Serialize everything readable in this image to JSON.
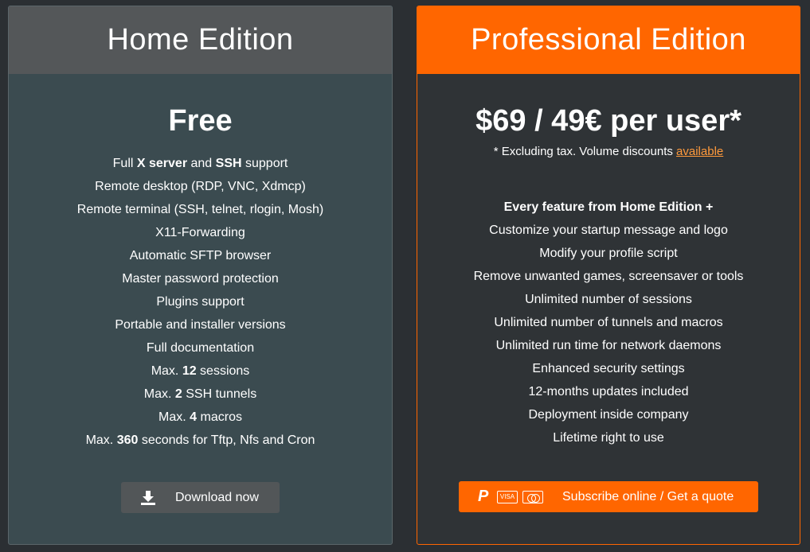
{
  "home": {
    "title": "Home Edition",
    "price": "Free",
    "features": [
      {
        "pre": "Full ",
        "bold": "X server",
        "mid": " and ",
        "bold2": "SSH",
        "post": " support"
      },
      {
        "pre": "Remote desktop (RDP, VNC, Xdmcp)"
      },
      {
        "pre": "Remote terminal (SSH, telnet, rlogin, Mosh)"
      },
      {
        "pre": "X11-Forwarding"
      },
      {
        "pre": "Automatic SFTP browser"
      },
      {
        "pre": "Master password protection"
      },
      {
        "pre": "Plugins support"
      },
      {
        "pre": "Portable and installer versions"
      },
      {
        "pre": "Full documentation"
      },
      {
        "pre": "Max. ",
        "bold": "12",
        "post": " sessions"
      },
      {
        "pre": "Max. ",
        "bold": "2",
        "post": " SSH tunnels"
      },
      {
        "pre": "Max. ",
        "bold": "4",
        "post": " macros"
      },
      {
        "pre": "Max. ",
        "bold": "360",
        "post": " seconds for Tftp, Nfs and Cron"
      }
    ],
    "button_label": "Download now",
    "button_icon": "download-icon",
    "header_color": "#545759",
    "body_color": "#3b4b50"
  },
  "pro": {
    "title": "Professional Edition",
    "price": "$69 / 49€ per user*",
    "note_text": "* Excluding tax. Volume discounts ",
    "note_link": "available",
    "features": [
      "Every feature from Home Edition +",
      "Customize your startup message and logo",
      "Modify your profile script",
      "Remove unwanted games, screensaver or tools",
      "Unlimited number of sessions",
      "Unlimited number of tunnels and macros",
      "Unlimited run time for network daemons",
      "Enhanced security settings",
      "12-months updates included",
      "Deployment inside company",
      "Lifetime right to use"
    ],
    "visa_label": "VISA",
    "button_label": "Subscribe online / Get a quote",
    "button_icons": [
      "paypal-icon",
      "visa-icon",
      "mastercard-icon"
    ],
    "accent_color": "#ff6600",
    "link_color": "#ff9a3c"
  }
}
